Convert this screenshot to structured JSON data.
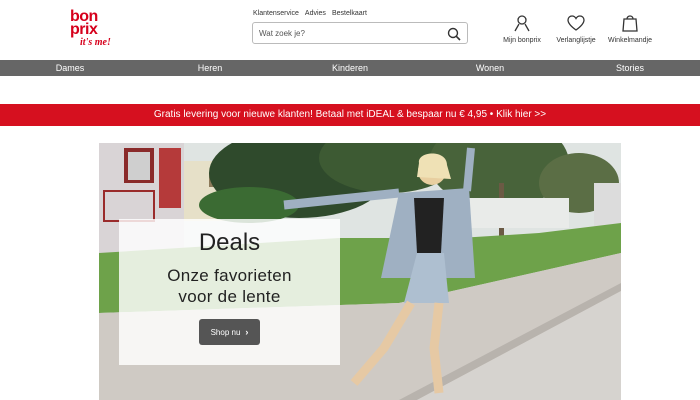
{
  "brand": {
    "logo_line1": "bon",
    "logo_line2": "prix",
    "logo_tagline": "it's me!"
  },
  "toplinks": [
    "Klantenservice",
    "Advies",
    "Bestelkaart"
  ],
  "search": {
    "placeholder": "Wat zoek je?"
  },
  "header_actions": {
    "account": "Mijn bonprix",
    "wishlist": "Verlanglijstje",
    "cart": "Winkelmandje"
  },
  "nav": [
    "Dames",
    "Heren",
    "Kinderen",
    "Wonen",
    "Stories"
  ],
  "promo": {
    "text": "Gratis levering voor nieuwe klanten! Betaal met iDEAL & bespaar nu € 4,95 • Klik hier >>"
  },
  "hero": {
    "title": "Deals",
    "subtitle_line1": "Onze favorieten",
    "subtitle_line2": "voor de lente",
    "button_label": "Shop nu"
  },
  "colors": {
    "brand_red": "#d6001c",
    "promo_red": "#d6101f",
    "nav_gray": "#666666",
    "button_gray": "#555555"
  }
}
